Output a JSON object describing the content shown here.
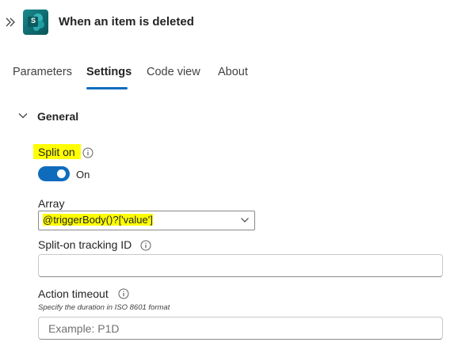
{
  "header": {
    "title": "When an item is deleted",
    "app_icon_letter": "S",
    "expand_icon": "double-chevron-right-icon",
    "app_icon": "sharepoint-icon"
  },
  "tabs": [
    {
      "label": "Parameters",
      "active": false
    },
    {
      "label": "Settings",
      "active": true
    },
    {
      "label": "Code view",
      "active": false
    },
    {
      "label": "About",
      "active": false
    }
  ],
  "section": {
    "title": "General",
    "expanded": true
  },
  "split_on": {
    "label": "Split on",
    "enabled": true,
    "state_label": "On"
  },
  "array": {
    "label": "Array",
    "value": "@triggerBody()?['value']"
  },
  "tracking_id": {
    "label": "Split-on tracking ID",
    "value": "",
    "placeholder": ""
  },
  "action_timeout": {
    "label": "Action timeout",
    "hint": "Specify the duration in ISO 8601 format",
    "value": "",
    "placeholder": "Example: P1D"
  },
  "colors": {
    "accent": "#0f6cbd",
    "highlight": "#ffff00",
    "app_icon": "#0f6b70"
  }
}
